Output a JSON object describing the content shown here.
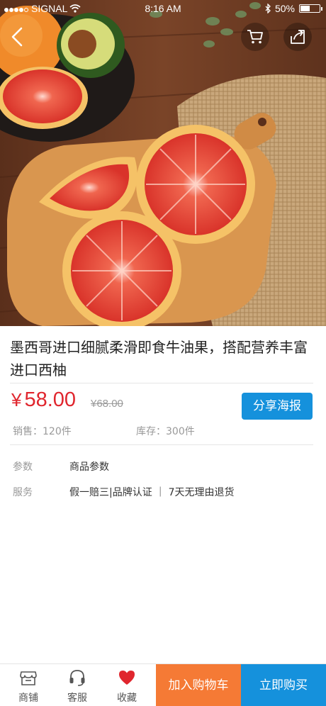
{
  "status_bar": {
    "carrier": "SIGNAL",
    "time": "8:16 AM",
    "battery": "50%",
    "battery_level": 0.5
  },
  "header": {
    "back_icon": "chevron-left-icon",
    "cart_icon": "cart-icon",
    "share_icon": "share-icon"
  },
  "hero": {
    "background_color": "#6b3a22",
    "fruit_color": "#e8432f",
    "board_color": "#d9964f"
  },
  "product": {
    "title": "墨西哥进口细腻柔滑即食牛油果，搭配营养丰富进口西柚",
    "currency": "¥",
    "price": "58.00",
    "original_price": "¥68.00",
    "share_poster_label": "分享海报",
    "sales": "销售：120件",
    "stock": "库存：300件"
  },
  "specs": {
    "params_key": "参数",
    "params_value": "商品参数",
    "service_key": "服务",
    "service_value": "假一赔三|品牌认证 ｜ 7天无理由退货"
  },
  "bottom_bar": {
    "shop_label": "商铺",
    "service_label": "客服",
    "favorite_label": "收藏",
    "add_to_cart_label": "加入购物车",
    "buy_now_label": "立即购买",
    "colors": {
      "add_to_cart": "#f57a35",
      "buy_now": "#1591dc",
      "favorite": "#e0262e",
      "price": "#e0262e"
    }
  }
}
